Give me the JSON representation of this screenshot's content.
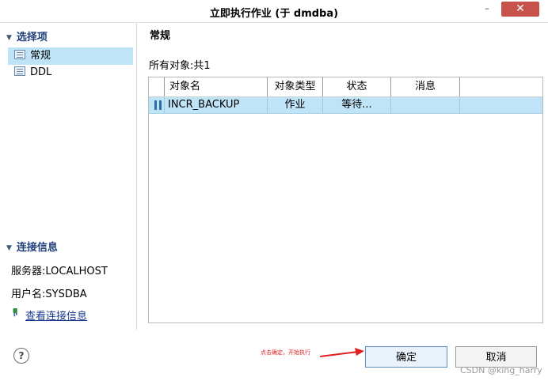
{
  "window": {
    "title": "立即执行作业 (于 dmdba)",
    "minimize_label": "–",
    "close_label": "✕"
  },
  "sidebar": {
    "options_header": "选择项",
    "items": [
      {
        "label": "常规",
        "icon": "page-icon",
        "selected": true
      },
      {
        "label": "DDL",
        "icon": "page-icon",
        "selected": false
      }
    ],
    "connection_header": "连接信息",
    "server_text": "服务器:LOCALHOST",
    "user_text": "用户名:SYSDBA",
    "view_link": "查看连接信息"
  },
  "main": {
    "title": "常规",
    "count_text": "所有对象:共1",
    "columns": [
      "对象名",
      "对象类型",
      "状态",
      "消息"
    ],
    "rows": [
      {
        "name": "INCR_BACKUP",
        "type": "作业",
        "status": "等待...",
        "message": ""
      }
    ]
  },
  "footer": {
    "help_label": "?",
    "annotation": "点击确定，开始执行",
    "ok_label": "确定",
    "cancel_label": "取消",
    "watermark": "CSDN @king_harry"
  },
  "colors": {
    "selection": "#bfe3f7",
    "close_button": "#c7514b",
    "annotation": "#e02020",
    "link": "#1a3a8f"
  }
}
